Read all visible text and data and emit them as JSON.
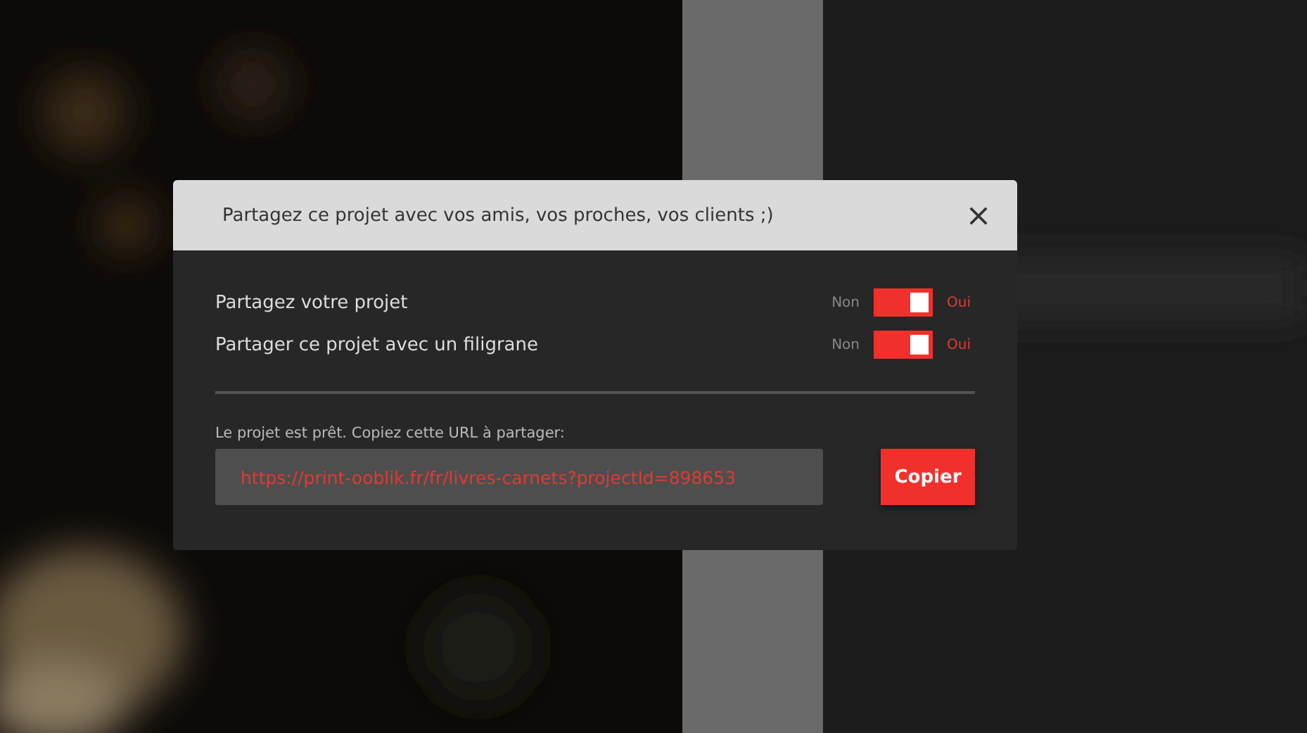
{
  "dialog": {
    "title": "Partagez ce projet avec vos amis, vos proches, vos clients ;)",
    "options": [
      {
        "label": "Partagez votre projet",
        "off_label": "Non",
        "on_label": "Oui",
        "on": true
      },
      {
        "label": "Partager ce projet avec un filigrane",
        "off_label": "Non",
        "on_label": "Oui",
        "on": true
      }
    ],
    "url_label": "Le projet est prêt. Copiez cette URL à partager:",
    "url_value": "https://print-ooblik.fr/fr/livres-carnets?projectId=898653",
    "copy_button": "Copier"
  }
}
